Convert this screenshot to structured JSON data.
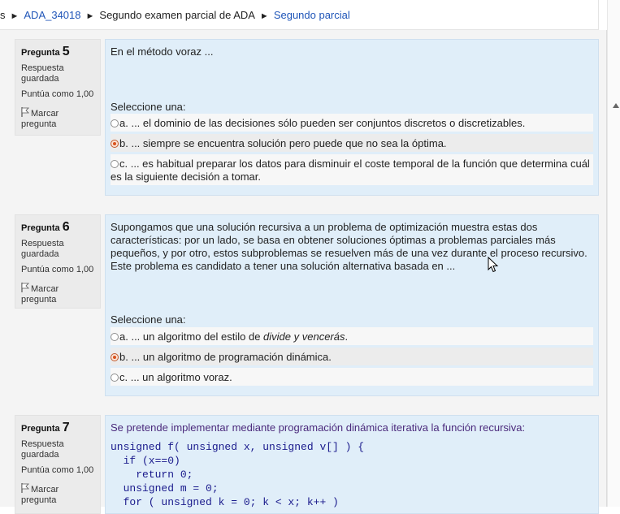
{
  "breadcrumb": {
    "prefix": "s",
    "items": [
      {
        "label": "ADA_34018",
        "link": true
      },
      {
        "label": "Segundo examen parcial de ADA",
        "link": false
      },
      {
        "label": "Segundo parcial",
        "link": true
      }
    ],
    "separator": "►"
  },
  "questions": [
    {
      "label": "Pregunta",
      "number": "5",
      "state": "Respuesta guardada",
      "grade": "Puntúa como 1,00",
      "flag": "Marcar pregunta",
      "text": "En el método voraz ...",
      "prompt": "Seleccione una:",
      "options": [
        {
          "text": "a. ... el dominio de las decisiones sólo pueden ser conjuntos discretos o discretizables.",
          "selected": false
        },
        {
          "text": "b. ... siempre se encuentra solución pero puede que no sea la óptima.",
          "selected": true
        },
        {
          "text": "c. ...  es habitual preparar los datos para disminuir el coste temporal de la función que determina cuál es la siguiente decisión a tomar.",
          "selected": false
        }
      ]
    },
    {
      "label": "Pregunta",
      "number": "6",
      "state": "Respuesta guardada",
      "grade": "Puntúa como 1,00",
      "flag": "Marcar pregunta",
      "text": "Supongamos que una solución recursiva  a un problema de optimización muestra estas dos características: por un lado, se basa en obtener soluciones óptimas a problemas parciales más pequeños, y por otro, estos subproblemas se resuelven más de una vez durante el proceso recursivo. Este problema es candidato a tener una solución alternativa basada en ...",
      "prompt": "Seleccione una:",
      "options": [
        {
          "text_before": "a. ... un algoritmo del estilo de ",
          "text_italic": "divide  y vencerás",
          "text_after": ".",
          "selected": false
        },
        {
          "text": "b. ... un algoritmo de programación dinámica.",
          "selected": true
        },
        {
          "text": "c. ... un algoritmo voraz.",
          "selected": false
        }
      ]
    },
    {
      "label": "Pregunta",
      "number": "7",
      "state": "Respuesta guardada",
      "grade": "Puntúa como 1,00",
      "flag": "Marcar pregunta",
      "text": "Se pretende implementar mediante programación dinámica iterativa la función recursiva:",
      "code": "unsigned f( unsigned x, unsigned v[] ) {\n  if (x==0)\n    return 0;\n  unsigned m = 0;\n  for ( unsigned k = 0; k < x; k++ )"
    }
  ],
  "colors": {
    "link": "#1f55b8",
    "question_bg": "#e0eef9",
    "info_bg": "#ebebeb",
    "selected_radio": "#d9531e"
  },
  "icons": [
    "flag-icon",
    "radio-icon",
    "mouse-cursor-icon",
    "scroll-up-arrow-icon"
  ]
}
